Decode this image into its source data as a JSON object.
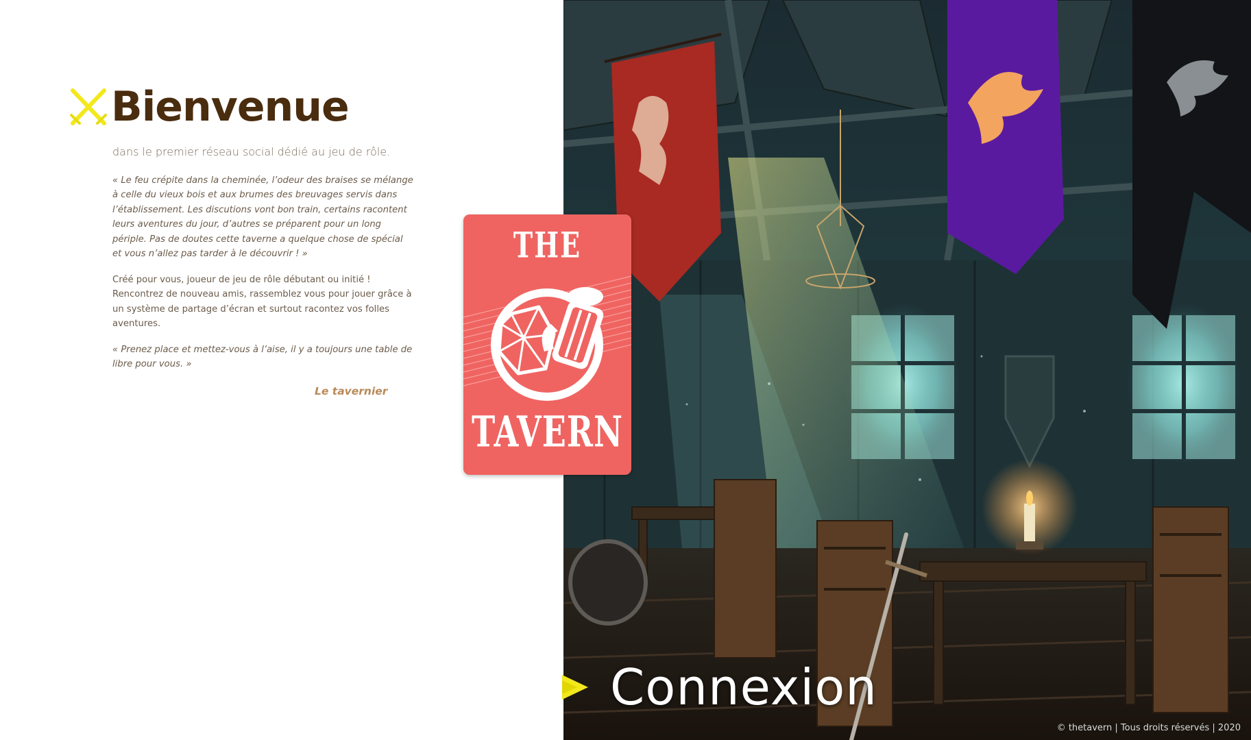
{
  "welcome": {
    "title": "Bienvenue",
    "subtitle": "dans le premier réseau social dédié au jeu de rôle.",
    "quote_one": "« Le feu crépite dans la cheminée, l’odeur des braises se mélange à celle du vieux bois et aux brumes des breuvages servis dans l’établissement. Les discutions vont bon train, certains racontent leurs aventures du jour, d’autres se préparent pour un long périple. Pas de doutes cette taverne a quelque chose de spécial et vous n’allez pas tarder à le découvrir ! »",
    "intro": "Créé pour vous, joueur de jeu de rôle débutant ou initié ! Rencontrez de nouveau amis, rassemblez vous pour jouer grâce à un système de partage d’écran et surtout racontez vos folles aventures.",
    "quote_two": "« Prenez place et mettez-vous à l’aise, il y a toujours une table de libre pour vous. »",
    "signature": "Le tavernier"
  },
  "logo": {
    "line_one": "THE",
    "line_two": "TAVERN"
  },
  "login": {
    "label": "Connexion"
  },
  "footer": {
    "text": "© thetavern | Tous droits réservés | 2020"
  },
  "colors": {
    "title": "#4a2c0f",
    "accent_yellow": "#f2e81c",
    "logo_red": "#ef6461",
    "signature": "#b88a5a"
  }
}
